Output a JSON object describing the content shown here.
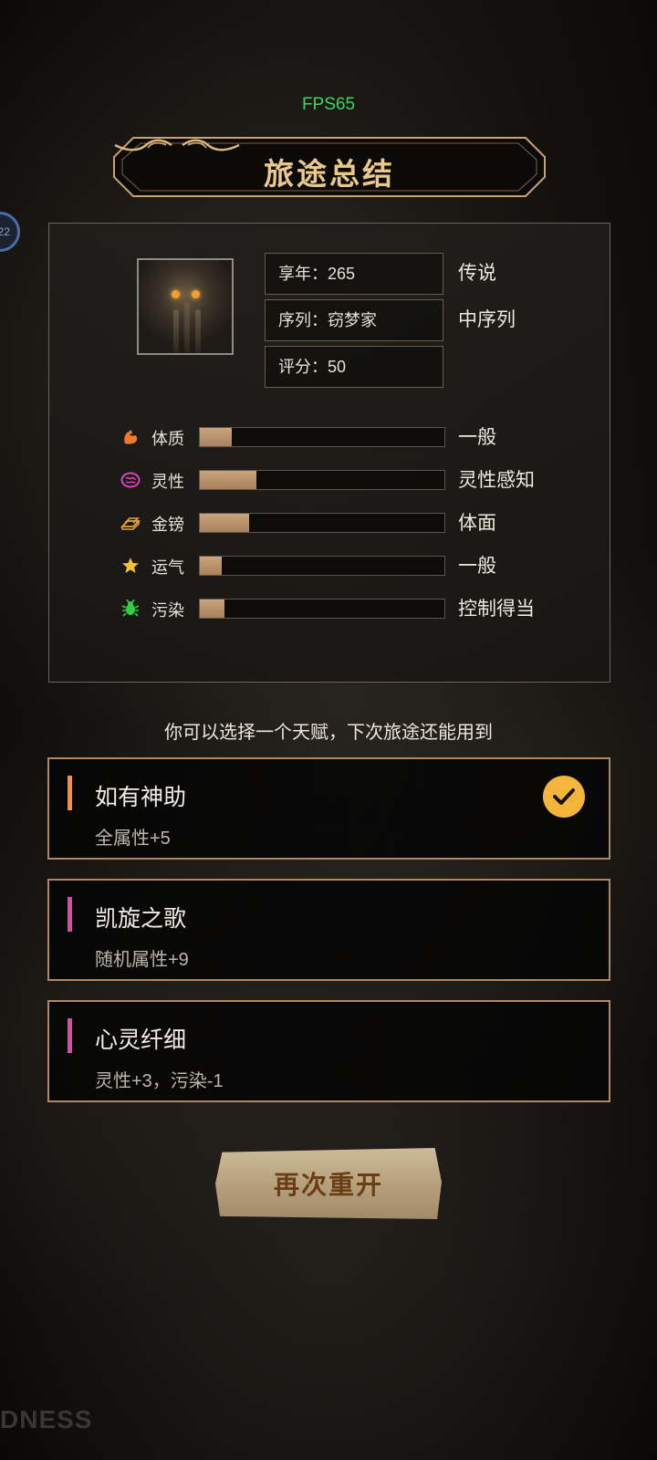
{
  "fps": "FPS65",
  "side_badge": "22",
  "title": "旅途总结",
  "summary": {
    "age": "享年：265",
    "age_tag": "传说",
    "sequence": "序列：窃梦家",
    "sequence_tag": "中序列",
    "score": "评分：50"
  },
  "stats": [
    {
      "name": "体质",
      "label": "一般",
      "icon": "muscle-icon",
      "color": "#f07a2a",
      "fill": 0.13
    },
    {
      "name": "灵性",
      "label": "灵性感知",
      "icon": "brain-icon",
      "color": "#d943b6",
      "fill": 0.23
    },
    {
      "name": "金镑",
      "label": "体面",
      "icon": "gold-bars-icon",
      "color": "#e8a23a",
      "fill": 0.2
    },
    {
      "name": "运气",
      "label": "一般",
      "icon": "star-icon",
      "color": "#f4c430",
      "fill": 0.09
    },
    {
      "name": "污染",
      "label": "控制得当",
      "icon": "bug-icon",
      "color": "#30d040",
      "fill": 0.1
    }
  ],
  "prompt": "你可以选择一个天赋，下次旅途还能用到",
  "talents": [
    {
      "title": "如有神助",
      "desc": "全属性+5",
      "accent": "#f0924a",
      "selected": true
    },
    {
      "title": "凯旋之歌",
      "desc": "随机属性+9",
      "accent": "#c9569e",
      "selected": false
    },
    {
      "title": "心灵纤细",
      "desc": "灵性+3，污染-1",
      "accent": "#c9569e",
      "selected": false
    }
  ],
  "restart_label": "再次重开",
  "watermark": "DNESS"
}
